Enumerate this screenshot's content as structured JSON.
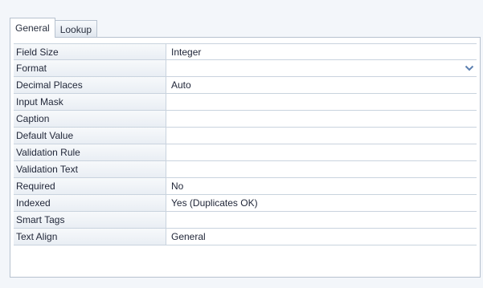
{
  "tabs": [
    {
      "label": "General",
      "active": true
    },
    {
      "label": "Lookup",
      "active": false
    }
  ],
  "properties": [
    {
      "name": "Field Size",
      "value": "Integer"
    },
    {
      "name": "Format",
      "value": "",
      "has_dropdown": true
    },
    {
      "name": "Decimal Places",
      "value": "Auto"
    },
    {
      "name": "Input Mask",
      "value": ""
    },
    {
      "name": "Caption",
      "value": ""
    },
    {
      "name": "Default Value",
      "value": ""
    },
    {
      "name": "Validation Rule",
      "value": ""
    },
    {
      "name": "Validation Text",
      "value": ""
    },
    {
      "name": "Required",
      "value": "No"
    },
    {
      "name": "Indexed",
      "value": "Yes (Duplicates OK)"
    },
    {
      "name": "Smart Tags",
      "value": ""
    },
    {
      "name": "Text Align",
      "value": "General"
    }
  ],
  "icons": {
    "dropdown": "chevron-down-icon"
  },
  "colors": {
    "dropdown_arrow": "#5b7fb0",
    "grid_line": "#c9d3de",
    "tab_border": "#b7c2cf"
  }
}
